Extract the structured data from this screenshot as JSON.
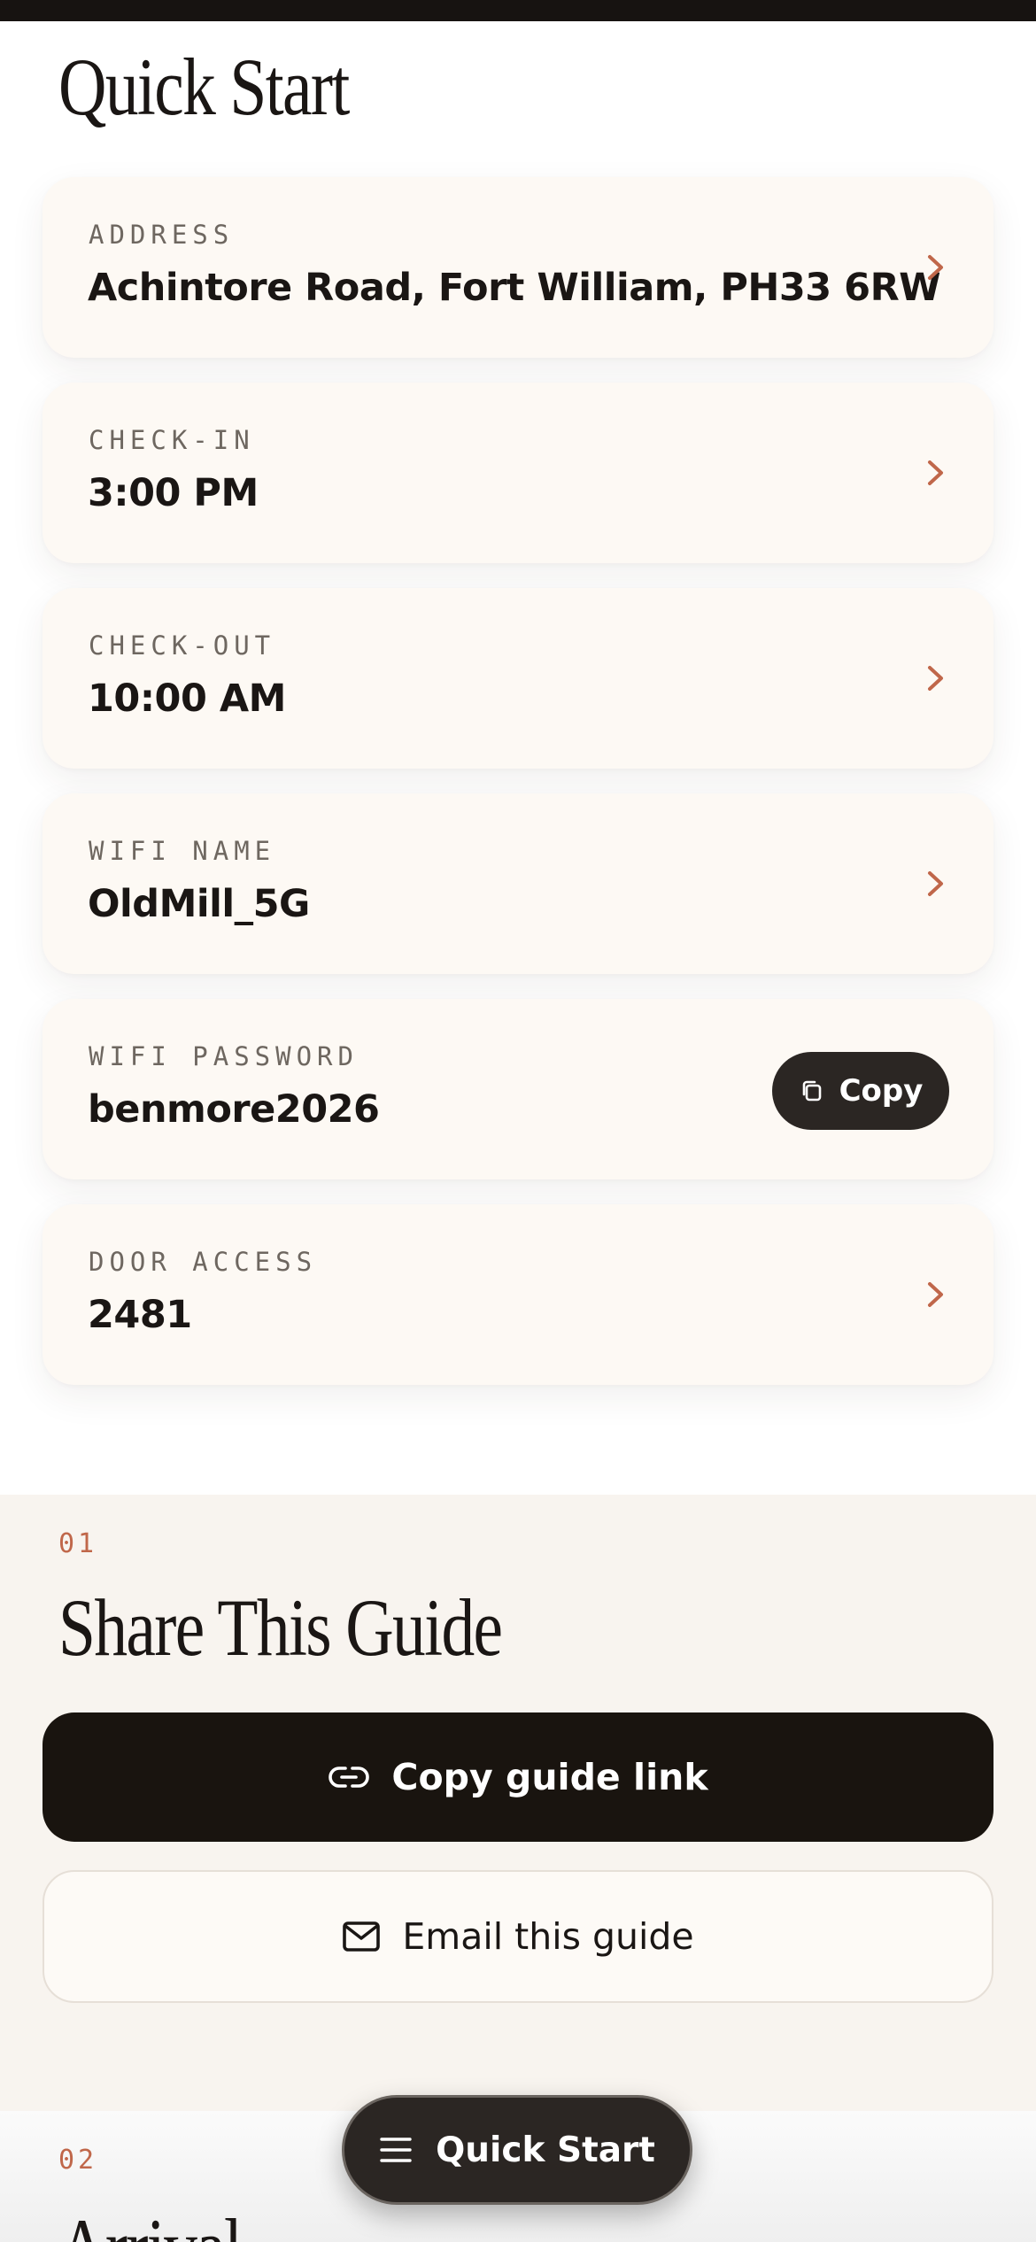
{
  "page": {
    "title": "Quick Start"
  },
  "cards": [
    {
      "label": "ADDRESS",
      "value": "Achintore Road, Fort William, PH33 6RW",
      "action": "chevron"
    },
    {
      "label": "CHECK-IN",
      "value": "3:00 PM",
      "action": "chevron"
    },
    {
      "label": "CHECK-OUT",
      "value": "10:00 AM",
      "action": "chevron"
    },
    {
      "label": "WIFI NAME",
      "value": "OldMill_5G",
      "action": "chevron"
    },
    {
      "label": "WIFI PASSWORD",
      "value": "benmore2026",
      "action": "copy",
      "action_label": "Copy"
    },
    {
      "label": "DOOR ACCESS",
      "value": "2481",
      "action": "chevron"
    }
  ],
  "share": {
    "number": "01",
    "title": "Share This Guide",
    "copy_link_label": "Copy guide link",
    "email_label": "Email this guide"
  },
  "arrival": {
    "number": "02",
    "title": "Arrival"
  },
  "fab": {
    "label": "Quick Start",
    "icon": "menu-icon"
  },
  "colors": {
    "accent": "#c0674a",
    "dark": "#19140f",
    "card_bg": "#fdf9f4",
    "section_bg": "#f8f4ef"
  }
}
